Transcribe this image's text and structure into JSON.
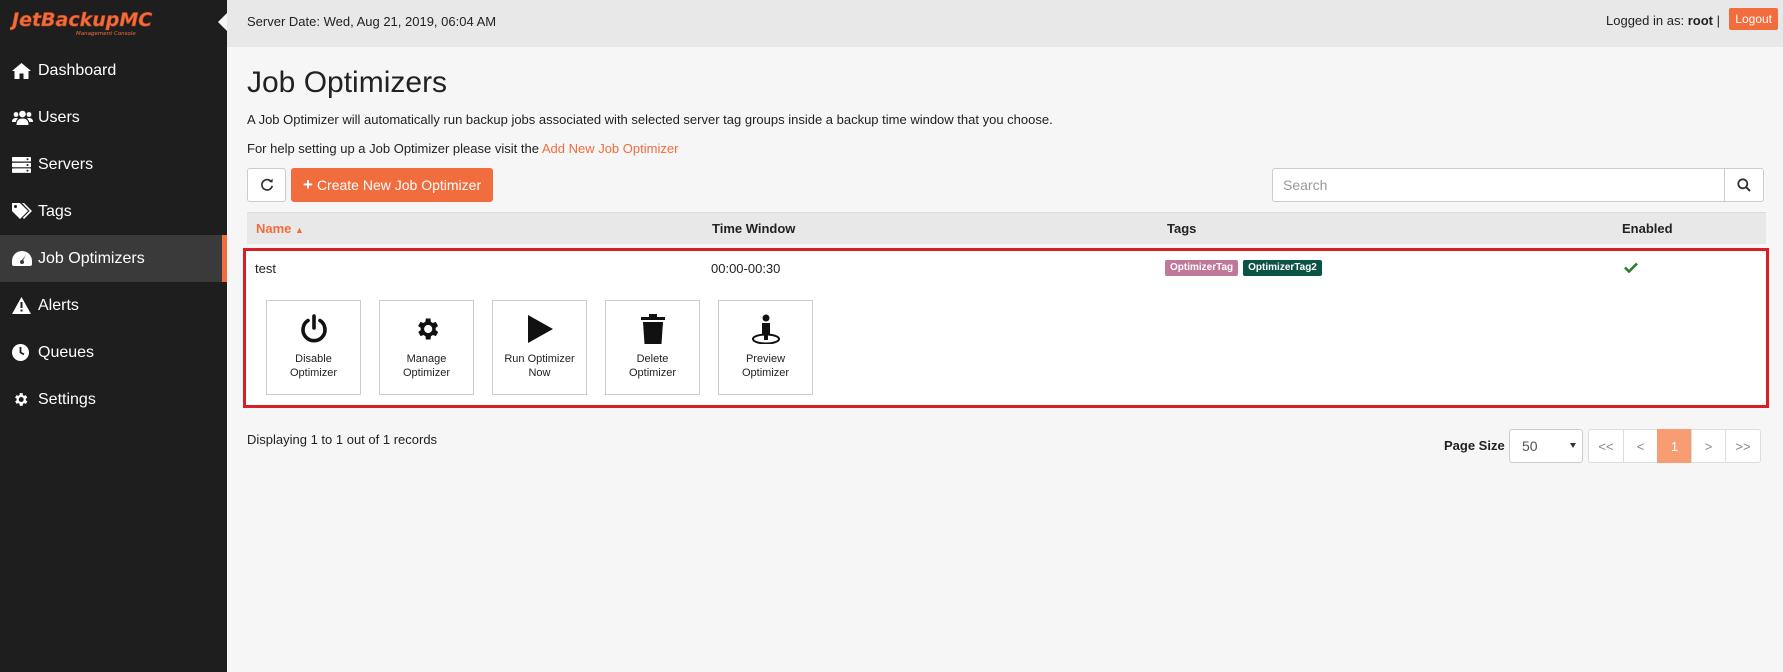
{
  "brand": {
    "name": "JetBackupMC",
    "tagline": "Management Console"
  },
  "sidebar": {
    "items": [
      {
        "label": "Dashboard",
        "icon": "home-icon"
      },
      {
        "label": "Users",
        "icon": "users-icon"
      },
      {
        "label": "Servers",
        "icon": "servers-icon"
      },
      {
        "label": "Tags",
        "icon": "tags-icon"
      },
      {
        "label": "Job Optimizers",
        "icon": "dashboard-gauge-icon",
        "active": true
      },
      {
        "label": "Alerts",
        "icon": "alert-icon"
      },
      {
        "label": "Queues",
        "icon": "clock-icon"
      },
      {
        "label": "Settings",
        "icon": "gear-icon"
      }
    ]
  },
  "topbar": {
    "server_date": "Server Date: Wed, Aug 21, 2019, 06:04 AM",
    "logged_in_prefix": "Logged in as:",
    "user": "root",
    "separator": "|",
    "logout": "Logout"
  },
  "page": {
    "title": "Job Optimizers",
    "description": "A Job Optimizer will automatically run backup jobs associated with selected server tag groups inside a backup time window that you choose.",
    "help_prefix": "For help setting up a Job Optimizer please visit the",
    "help_link": "Add New Job Optimizer",
    "create_button": "Create New Job Optimizer",
    "search_placeholder": "Search"
  },
  "table": {
    "columns": {
      "name": "Name",
      "time": "Time Window",
      "tags": "Tags",
      "enabled": "Enabled"
    },
    "rows": [
      {
        "name": "test",
        "time_window": "00:00-00:30",
        "tags": [
          {
            "label": "OptimizerTag",
            "color": "#c0789a"
          },
          {
            "label": "OptimizerTag2",
            "color": "#0b5345"
          }
        ],
        "enabled": true,
        "actions": [
          {
            "line1": "Disable",
            "line2": "Optimizer",
            "icon": "power-icon"
          },
          {
            "line1": "Manage",
            "line2": "Optimizer",
            "icon": "gear-icon"
          },
          {
            "line1": "Run Optimizer",
            "line2": "Now",
            "icon": "play-icon"
          },
          {
            "line1": "Delete",
            "line2": "Optimizer",
            "icon": "trash-icon"
          },
          {
            "line1": "Preview",
            "line2": "Optimizer",
            "icon": "preview-person-icon"
          }
        ]
      }
    ]
  },
  "footer": {
    "displaying": "Displaying 1 to 1 out of 1 records",
    "page_size_label": "Page Size",
    "page_size_value": "50",
    "pager": [
      "<<",
      "<",
      "1",
      ">",
      ">>"
    ],
    "current_page": "1"
  },
  "colors": {
    "accent": "#f26d3d",
    "sidebar": "#1e1e1e",
    "highlight_border": "#d91e26",
    "check": "#2e7d32"
  }
}
